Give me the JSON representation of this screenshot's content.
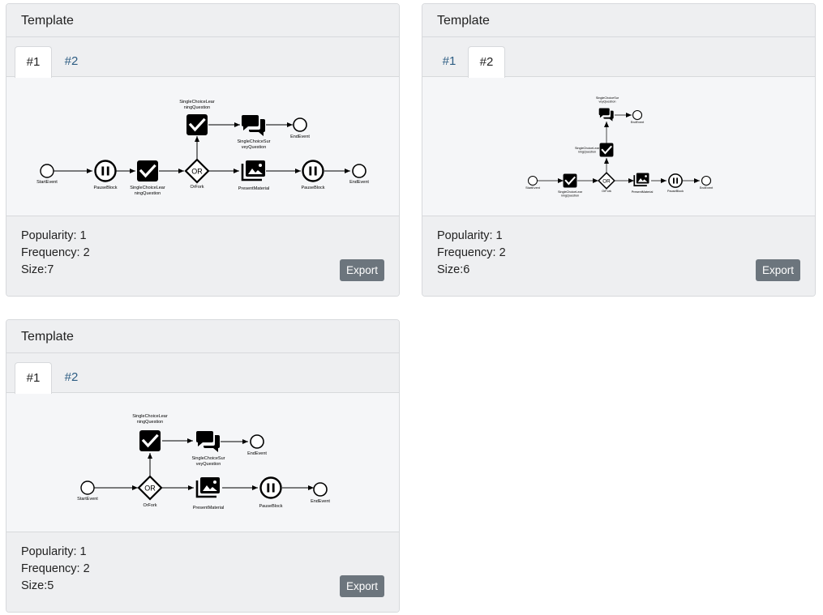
{
  "cards": [
    {
      "title": "Template",
      "tabs": [
        "#1",
        "#2"
      ],
      "active_tab": 0,
      "stats": {
        "popularity": "Popularity: 1",
        "frequency": "Frequency: 2",
        "size": "Size:7"
      },
      "export_label": "Export",
      "diagram": {
        "start_event": "StartEvent",
        "pause_block_1": "PauseBlock",
        "single_choice_1_line1": "SingleChoiceLear",
        "single_choice_1_line2": "ningQuestion",
        "or_fork": "OrFork",
        "or_label": "OR",
        "single_choice_2_line1": "SingleChoiceLear",
        "single_choice_2_line2": "ningQuestion",
        "survey_line1": "SingleChoiceSur",
        "survey_line2": "veyQuestion",
        "end_event_top": "EndEvent",
        "present_material": "PresentMaterial",
        "pause_block_2": "PauseBlock",
        "end_event": "EndEvent"
      }
    },
    {
      "title": "Template",
      "tabs": [
        "#1",
        "#2"
      ],
      "active_tab": 1,
      "stats": {
        "popularity": "Popularity: 1",
        "frequency": "Frequency: 2",
        "size": "Size:6"
      },
      "export_label": "Export",
      "diagram": {
        "start_event": "StartEvent",
        "single_choice_1_line1": "SingleChoiceLear",
        "single_choice_1_line2": "ningQuestion",
        "or_fork": "OrFork",
        "or_label": "OR",
        "single_choice_2_line1": "SingleChoiceLear",
        "single_choice_2_line2": "ningQuestion",
        "survey_line1": "SingleChoiceSur",
        "survey_line2": "veyQuestion",
        "end_event_top": "EndEvent",
        "present_material": "PresentMaterial",
        "pause_block": "PauseBlock",
        "end_event": "EndEvent"
      }
    },
    {
      "title": "Template",
      "tabs": [
        "#1",
        "#2"
      ],
      "active_tab": 0,
      "stats": {
        "popularity": "Popularity: 1",
        "frequency": "Frequency: 2",
        "size": "Size:5"
      },
      "export_label": "Export",
      "diagram": {
        "start_event": "StartEvent",
        "or_fork": "OrFork",
        "or_label": "OR",
        "single_choice_line1": "SingleChoiceLear",
        "single_choice_line2": "ningQuestion",
        "survey_line1": "SingleChoiceSur",
        "survey_line2": "veyQuestion",
        "end_event_top": "EndEvent",
        "present_material": "PresentMaterial",
        "pause_block": "PauseBlock",
        "end_event": "EndEvent"
      }
    }
  ]
}
